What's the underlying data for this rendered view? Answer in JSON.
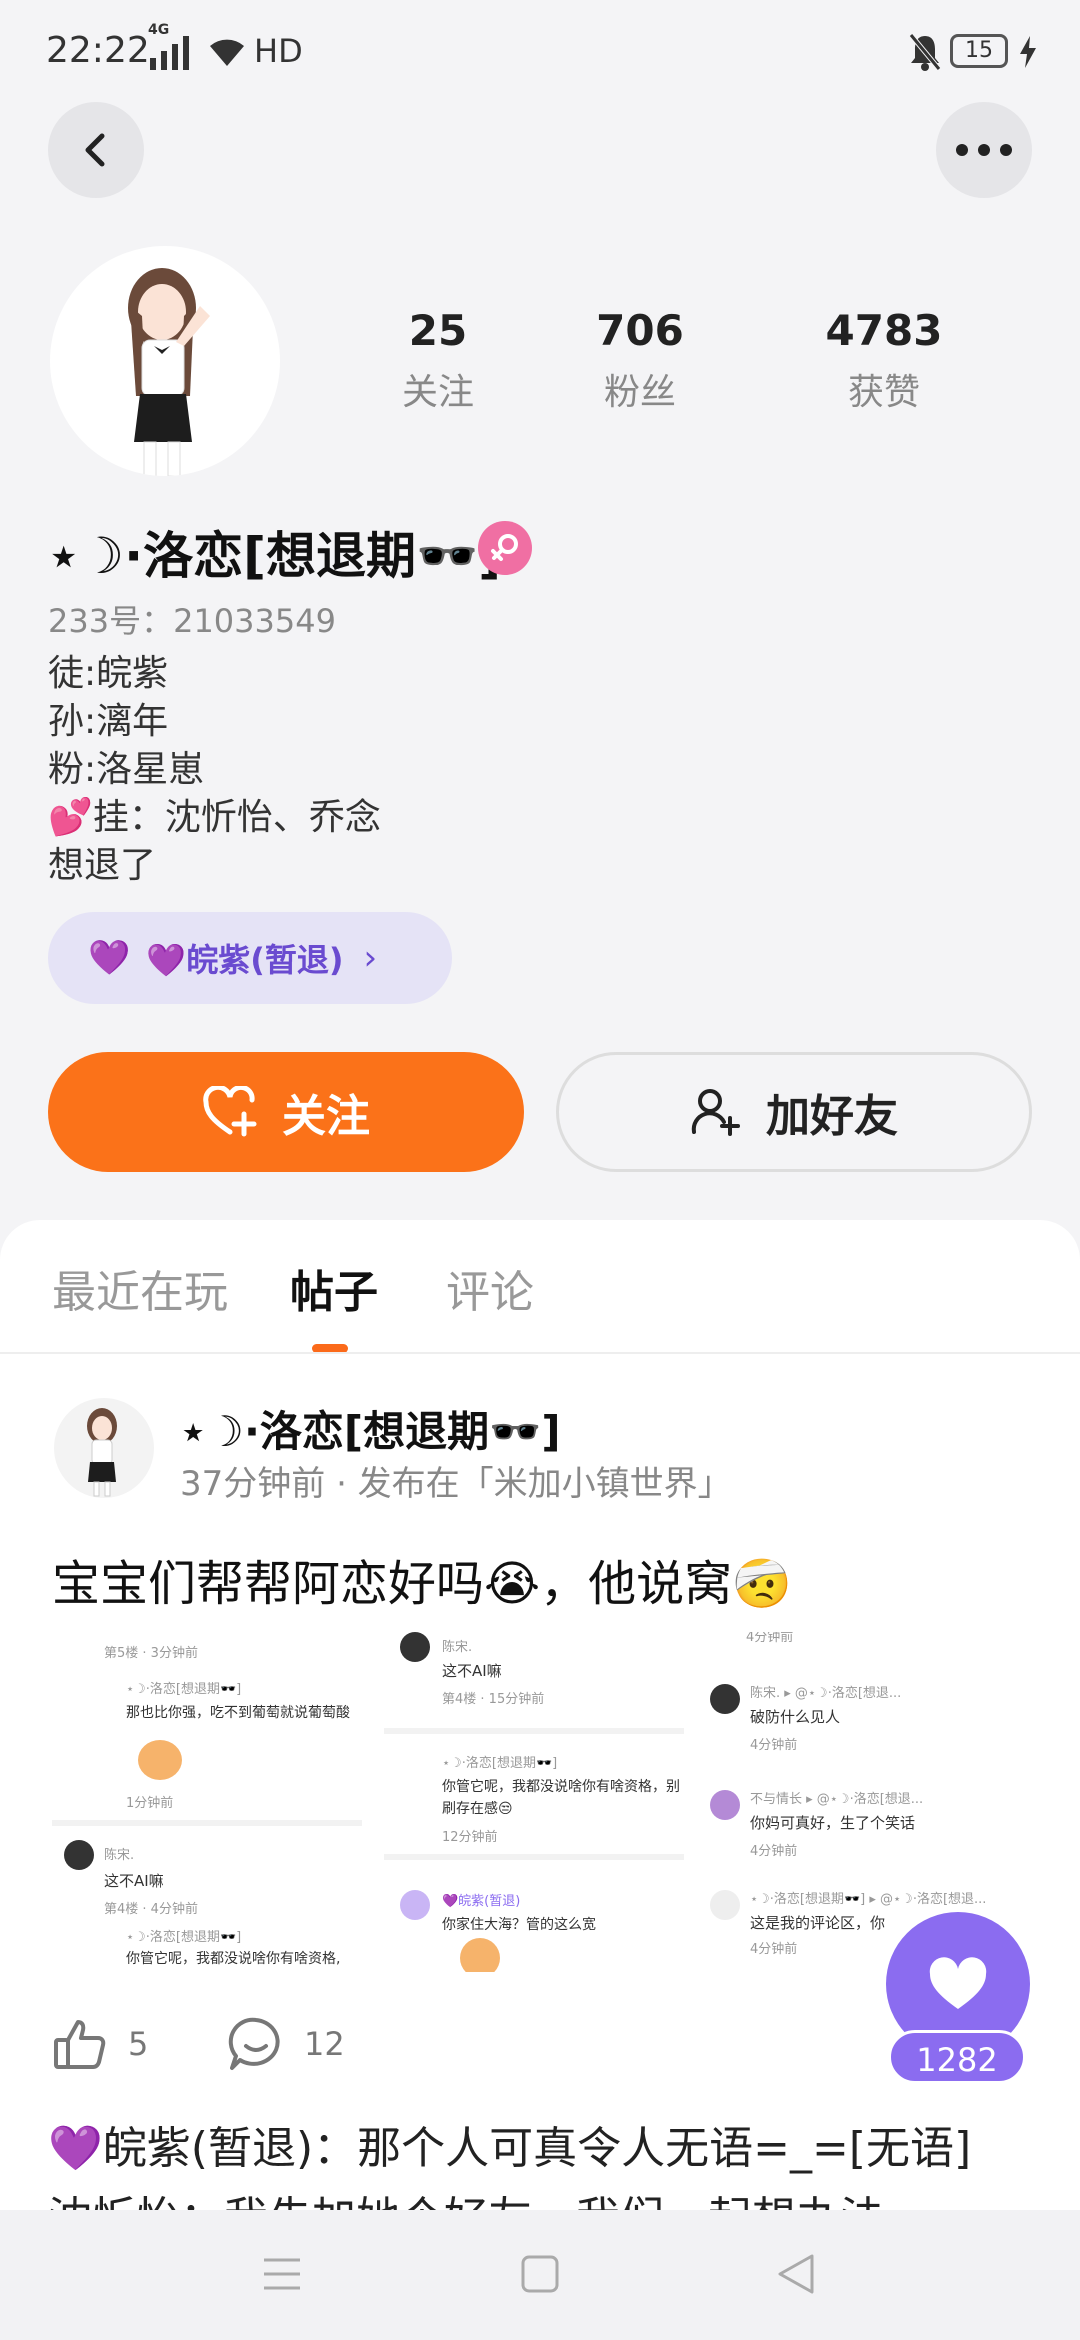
{
  "status_bar": {
    "time": "22:22",
    "network": "4G",
    "hd": "HD",
    "battery": "15"
  },
  "profile": {
    "stats": [
      {
        "value": "25",
        "label": "关注"
      },
      {
        "value": "706",
        "label": "粉丝"
      },
      {
        "value": "4783",
        "label": "获赞"
      }
    ],
    "nickname": "⋆☽·洛恋[想退期🕶️]",
    "uid": "233号：21033549",
    "bio": [
      "徒:皖紫",
      "孙:漓年",
      "粉:洛星崽",
      "💕挂：沈忻怡、乔念",
      "想退了"
    ],
    "guild_chip": {
      "icon": "💜",
      "label": "💜皖紫(暂退)",
      "chevron": "›"
    },
    "follow_label": "关注",
    "add_friend_label": "加好友"
  },
  "tabs": [
    {
      "label": "最近在玩",
      "active": false
    },
    {
      "label": "帖子",
      "active": true
    },
    {
      "label": "评论",
      "active": false
    }
  ],
  "post": {
    "author": "⋆☽·洛恋[想退期🕶️]",
    "meta": "37分钟前 · 发布在「米加小镇世界」",
    "text": "宝宝们帮帮阿恋好吗😭，他说窝🤕",
    "images": {
      "shot1": [
        "第5楼 · 3分钟前",
        "⋆☽·洛恋[想退期🕶️]",
        "那也比你强，吃不到葡萄就说葡萄酸",
        "1分钟前",
        "陈宋.",
        "这不AI嘛",
        "第4楼 · 4分钟前",
        "⋆☽·洛恋[想退期🕶️]",
        "你管它呢，我都没说啥你有啥资格,"
      ],
      "shot2": [
        "陈宋.",
        "这不AI嘛",
        "第4楼 · 15分钟前",
        "⋆☽·洛恋[想退期🕶️]",
        "你管它呢，我都没说啥你有啥资格，别",
        "刷存在感😒",
        "12分钟前",
        "💜皖紫(暂退)",
        "你家住大海？管的这么宽"
      ],
      "shot3": [
        "4分钟前",
        "陈宋. ▸ @⋆☽·洛恋[想退...",
        "破防什么见人",
        "4分钟前",
        "不与情长 ▸ @⋆☽·洛恋[想退...",
        "你妈可真好，生了个笑话",
        "4分钟前",
        "⋆☽·洛恋[想退期🕶️] ▸ @⋆☽·洛恋[想退...",
        "这是我的评论区，你",
        "4分钟前"
      ]
    },
    "like_count": "5",
    "comment_count": "12",
    "fab_like_count": "1282"
  },
  "comment_preview": {
    "line1": "💜皖紫(暂退)：那个人可真令人无语=_=[无语]",
    "line2": "沈忻怡：我先加她个好友，我们一起想办法"
  },
  "colors": {
    "accent": "#fb7219",
    "purple": "#8b6cf0",
    "chip_bg": "#e5e3f6"
  }
}
